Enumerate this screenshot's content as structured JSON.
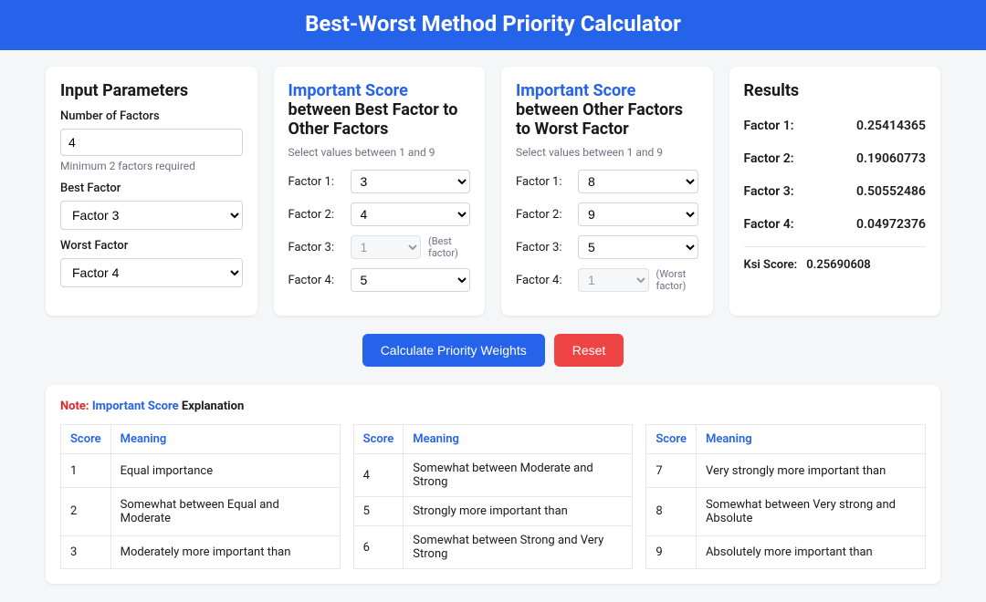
{
  "header": {
    "title": "Best-Worst Method Priority Calculator"
  },
  "input_params": {
    "title": "Input Parameters",
    "num_label": "Number of Factors",
    "num_value": "4",
    "num_hint": "Minimum 2 factors required",
    "best_label": "Best Factor",
    "best_value": "Factor 3",
    "worst_label": "Worst Factor",
    "worst_value": "Factor 4"
  },
  "best_panel": {
    "title_hl": "Important Score",
    "title_rest": " between Best Factor to Other Factors",
    "subhint": "Select values between 1 and 9",
    "rows": [
      {
        "label": "Factor 1:",
        "value": "3",
        "disabled": false,
        "note": ""
      },
      {
        "label": "Factor 2:",
        "value": "4",
        "disabled": false,
        "note": ""
      },
      {
        "label": "Factor 3:",
        "value": "1",
        "disabled": true,
        "note": "(Best factor)"
      },
      {
        "label": "Factor 4:",
        "value": "5",
        "disabled": false,
        "note": ""
      }
    ]
  },
  "worst_panel": {
    "title_hl": "Important Score",
    "title_rest": " between Other Factors to Worst Factor",
    "subhint": "Select values between 1 and 9",
    "rows": [
      {
        "label": "Factor 1:",
        "value": "8",
        "disabled": false,
        "note": ""
      },
      {
        "label": "Factor 2:",
        "value": "9",
        "disabled": false,
        "note": ""
      },
      {
        "label": "Factor 3:",
        "value": "5",
        "disabled": false,
        "note": ""
      },
      {
        "label": "Factor 4:",
        "value": "1",
        "disabled": true,
        "note": "(Worst factor)"
      }
    ]
  },
  "results": {
    "title": "Results",
    "rows": [
      {
        "label": "Factor 1:",
        "value": "0.25414365"
      },
      {
        "label": "Factor 2:",
        "value": "0.19060773"
      },
      {
        "label": "Factor 3:",
        "value": "0.50552486"
      },
      {
        "label": "Factor 4:",
        "value": "0.04972376"
      }
    ],
    "ksi_label": "Ksi Score:",
    "ksi_value": "0.25690608"
  },
  "buttons": {
    "calc": "Calculate Priority Weights",
    "reset": "Reset"
  },
  "explanation": {
    "note": "Note:",
    "hl": " Important Score ",
    "rest": "Explanation",
    "th_score": "Score",
    "th_meaning": "Meaning",
    "tables": [
      [
        {
          "score": "1",
          "meaning": "Equal importance"
        },
        {
          "score": "2",
          "meaning": "Somewhat between Equal and Moderate"
        },
        {
          "score": "3",
          "meaning": "Moderately more important than"
        }
      ],
      [
        {
          "score": "4",
          "meaning": "Somewhat between Moderate and Strong"
        },
        {
          "score": "5",
          "meaning": "Strongly more important than"
        },
        {
          "score": "6",
          "meaning": "Somewhat between Strong and Very Strong"
        }
      ],
      [
        {
          "score": "7",
          "meaning": "Very strongly more important than"
        },
        {
          "score": "8",
          "meaning": "Somewhat between Very strong and Absolute"
        },
        {
          "score": "9",
          "meaning": "Absolutely more important than"
        }
      ]
    ]
  }
}
